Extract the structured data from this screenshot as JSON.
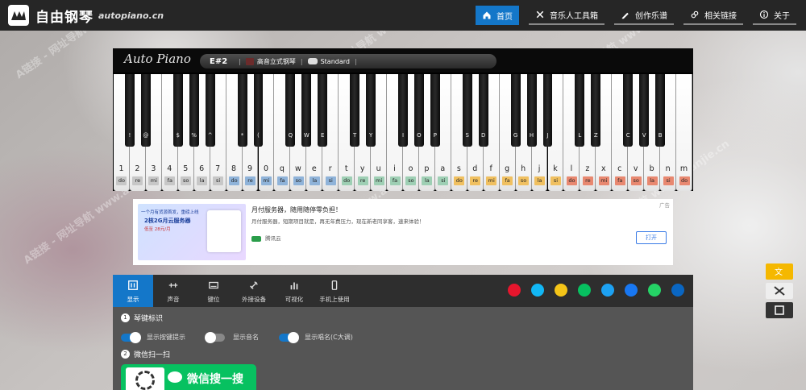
{
  "header": {
    "logo_text": "自由钢琴",
    "logo_sub": "autopiano.cn",
    "nav": [
      {
        "label": "首页",
        "icon": "home-icon",
        "active": true
      },
      {
        "label": "音乐人工具箱",
        "icon": "tools-icon",
        "active": false
      },
      {
        "label": "创作乐谱",
        "icon": "pen-icon",
        "active": false
      },
      {
        "label": "相关链接",
        "icon": "link-icon",
        "active": false
      },
      {
        "label": "关于",
        "icon": "info-icon",
        "active": false
      }
    ]
  },
  "piano": {
    "brand": "Auto Piano",
    "current_key": "E#2",
    "instrument": "高音立式钢琴",
    "mode": "Standard",
    "black_keys": [
      "!",
      "@",
      "$",
      "%",
      "^",
      "*",
      "(",
      "Q",
      "W",
      "E",
      "T",
      "Y",
      "I",
      "O",
      "P",
      "S",
      "D",
      "G",
      "H",
      "J",
      "L",
      "Z",
      "C",
      "V",
      "B"
    ],
    "white_keys": [
      {
        "label": "1",
        "solfege": "do"
      },
      {
        "label": "2",
        "solfege": "re"
      },
      {
        "label": "3",
        "solfege": "mi"
      },
      {
        "label": "4",
        "solfege": "fa"
      },
      {
        "label": "5",
        "solfege": "so"
      },
      {
        "label": "6",
        "solfege": "la"
      },
      {
        "label": "7",
        "solfege": "si"
      },
      {
        "label": "8",
        "solfege": "do"
      },
      {
        "label": "9",
        "solfege": "re"
      },
      {
        "label": "0",
        "solfege": "mi"
      },
      {
        "label": "q",
        "solfege": "fa"
      },
      {
        "label": "w",
        "solfege": "so"
      },
      {
        "label": "e",
        "solfege": "la"
      },
      {
        "label": "r",
        "solfege": "si"
      },
      {
        "label": "t",
        "solfege": "do"
      },
      {
        "label": "y",
        "solfege": "re"
      },
      {
        "label": "u",
        "solfege": "mi"
      },
      {
        "label": "i",
        "solfege": "fa"
      },
      {
        "label": "o",
        "solfege": "so"
      },
      {
        "label": "p",
        "solfege": "la"
      },
      {
        "label": "a",
        "solfege": "si"
      },
      {
        "label": "s",
        "solfege": "do"
      },
      {
        "label": "d",
        "solfege": "re"
      },
      {
        "label": "f",
        "solfege": "mi"
      },
      {
        "label": "g",
        "solfege": "fa"
      },
      {
        "label": "h",
        "solfege": "so"
      },
      {
        "label": "j",
        "solfege": "la"
      },
      {
        "label": "k",
        "solfege": "si"
      },
      {
        "label": "l",
        "solfege": "do"
      },
      {
        "label": "z",
        "solfege": "re"
      },
      {
        "label": "x",
        "solfege": "mi"
      },
      {
        "label": "c",
        "solfege": "fa"
      },
      {
        "label": "v",
        "solfege": "so"
      },
      {
        "label": "b",
        "solfege": "la"
      },
      {
        "label": "n",
        "solfege": "si"
      },
      {
        "label": "m",
        "solfege": "do"
      }
    ],
    "octave_colors": [
      "#c7c7c7",
      "#8fb3d9",
      "#9ecfb4",
      "#f0c060",
      "#e88870"
    ]
  },
  "ad": {
    "title": "月付服务器，随用随停零负担！",
    "desc": "月付服务器，短期项目就是，再无年费压力，现在新老同享客，速来体验！",
    "source": "腾讯云",
    "button": "打开",
    "tag": "广告",
    "img_text_1": "一个月有货源首发，重磅上线",
    "img_text_2": "2核2G月云服务器",
    "img_text_3": "低至 28元/月"
  },
  "tabs": [
    {
      "label": "显示",
      "icon": "display-icon",
      "active": true
    },
    {
      "label": "声音",
      "icon": "sound-icon",
      "active": false
    },
    {
      "label": "键位",
      "icon": "keyboard-icon",
      "active": false
    },
    {
      "label": "外接设备",
      "icon": "plug-icon",
      "active": false
    },
    {
      "label": "可视化",
      "icon": "chart-icon",
      "active": false
    },
    {
      "label": "手机上使用",
      "icon": "phone-icon",
      "active": false
    }
  ],
  "social": [
    {
      "name": "weibo-icon",
      "color": "#e6162d"
    },
    {
      "name": "qq-icon",
      "color": "#12b7f5"
    },
    {
      "name": "qzone-icon",
      "color": "#f5c518"
    },
    {
      "name": "wechat-icon",
      "color": "#07c160"
    },
    {
      "name": "twitter-icon",
      "color": "#1da1f2"
    },
    {
      "name": "facebook-icon",
      "color": "#1877f2"
    },
    {
      "name": "whatsapp-icon",
      "color": "#25d366"
    },
    {
      "name": "linkedin-icon",
      "color": "#0a66c2"
    }
  ],
  "display_panel": {
    "section1_num": "1",
    "section1_title": "琴键标识",
    "toggles": [
      {
        "label": "显示按键提示",
        "on": true
      },
      {
        "label": "显示音名",
        "on": false
      },
      {
        "label": "显示唱名(C大调)",
        "on": true
      }
    ],
    "section2_num": "2",
    "section2_title": "微信扫一扫",
    "wechat_search": "微信搜一搜"
  },
  "watermark": "A链接 - 网址导航  www.alianjie.cn"
}
